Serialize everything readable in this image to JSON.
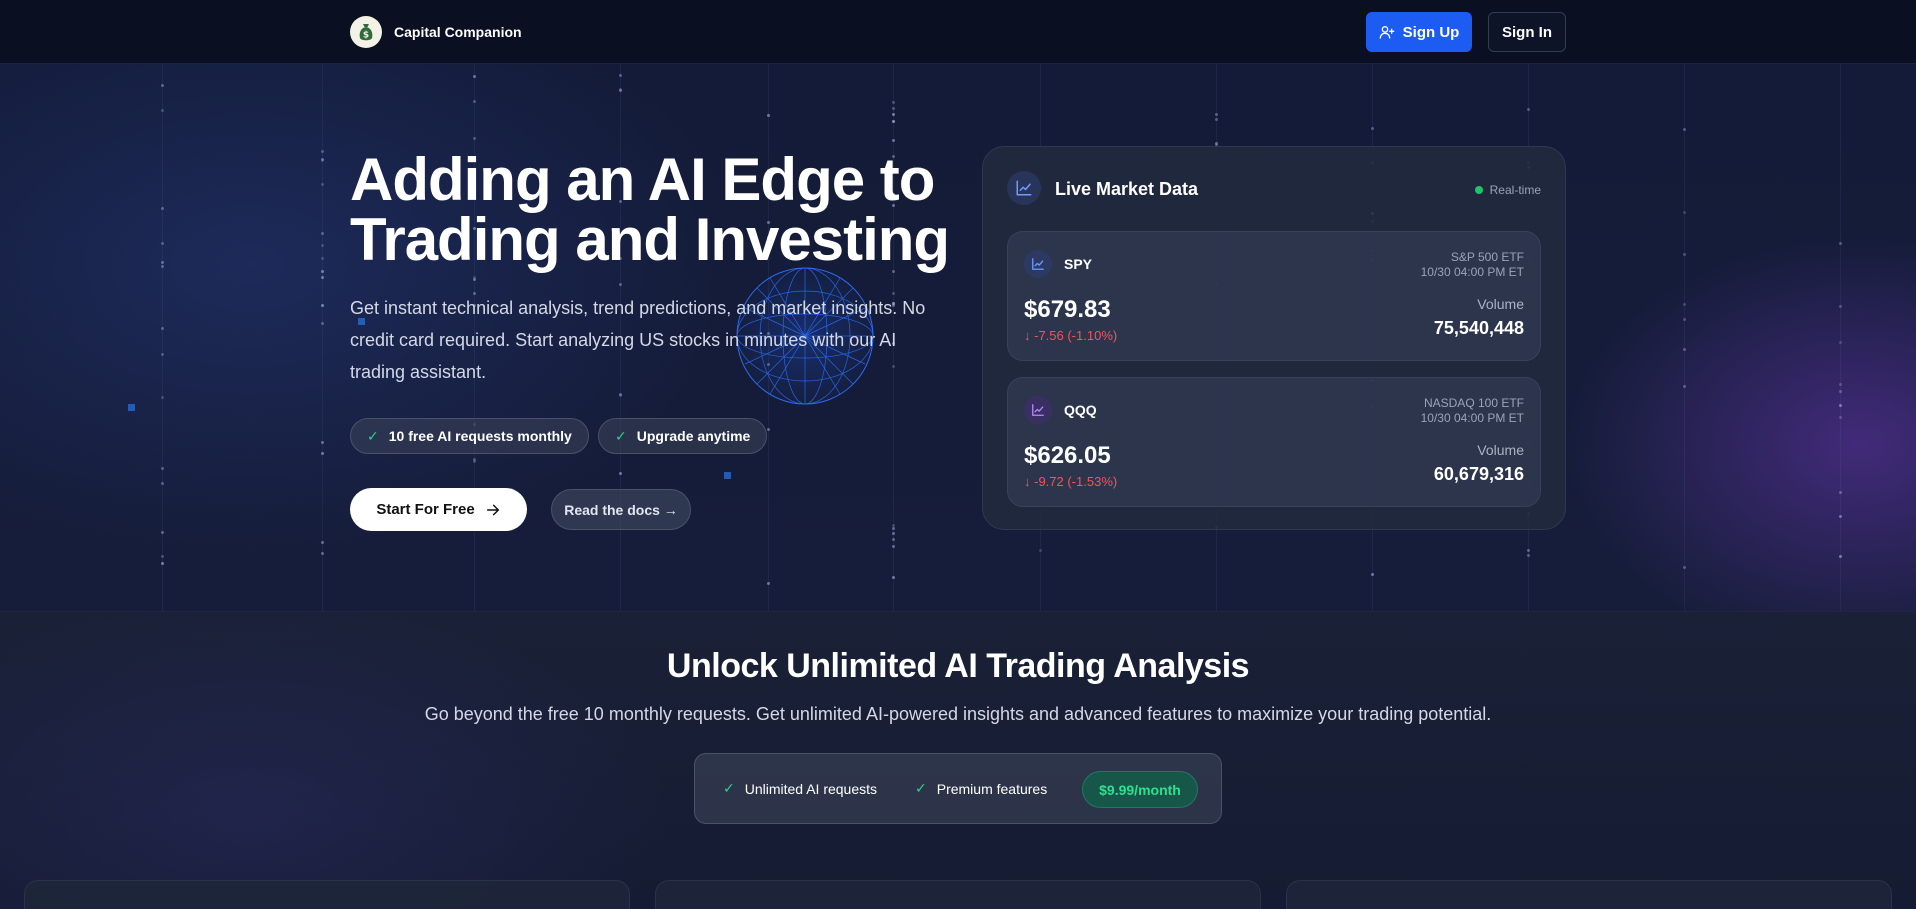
{
  "header": {
    "brand_name": "Capital Companion",
    "signup_label": "Sign Up",
    "signin_label": "Sign In"
  },
  "hero": {
    "title_line1": "Adding an AI Edge to",
    "title_line2": "Trading and Investing",
    "subtitle": "Get instant technical analysis, trend predictions, and market insights. No credit card required. Start analyzing US stocks in minutes with our AI trading assistant.",
    "chips": [
      "10 free AI requests monthly",
      "Upgrade anytime"
    ],
    "start_label": "Start For Free",
    "docs_label": "Read the docs →"
  },
  "market": {
    "title": "Live Market Data",
    "status": "Real-time",
    "tickers": [
      {
        "symbol": "SPY",
        "name": "S&P 500 ETF",
        "time": "10/30 04:00 PM ET",
        "price": "$679.83",
        "change": "↓ -7.56 (-1.10%)",
        "volume_label": "Volume",
        "volume": "75,540,448"
      },
      {
        "symbol": "QQQ",
        "name": "NASDAQ 100 ETF",
        "time": "10/30 04:00 PM ET",
        "price": "$626.05",
        "change": "↓ -9.72 (-1.53%)",
        "volume_label": "Volume",
        "volume": "60,679,316"
      }
    ]
  },
  "upgrade": {
    "title": "Unlock Unlimited AI Trading Analysis",
    "subtitle": "Go beyond the free 10 monthly requests. Get unlimited AI-powered insights and advanced features to maximize your trading potential.",
    "features": [
      "Unlimited AI requests",
      "Premium features"
    ],
    "price": "$9.99/month"
  },
  "colors": {
    "accent_blue": "#1d5cf2",
    "down_red": "#f2555a",
    "live_green": "#1fc46a",
    "check_green": "#2fd08a"
  }
}
